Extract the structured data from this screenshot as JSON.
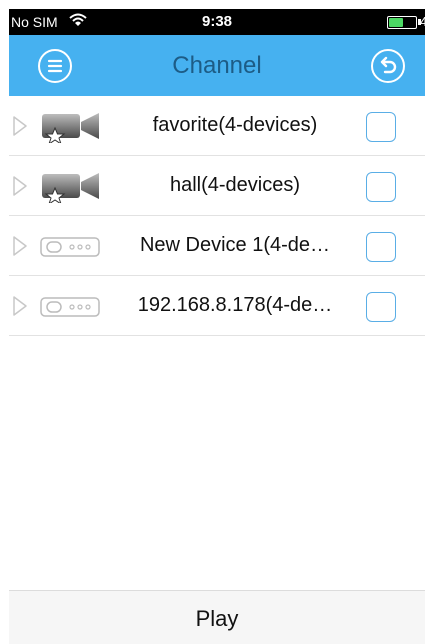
{
  "status_bar": {
    "carrier": "No SIM",
    "time": "9:38",
    "battery_level": 0.55,
    "battery_color": "#4cd964",
    "extra": "4"
  },
  "navbar": {
    "title": "Channel",
    "menu_icon": "hamburger-menu-icon",
    "back_icon": "undo-back-icon",
    "color": "#46b1f0",
    "title_color": "#1d5c86"
  },
  "channels": [
    {
      "label": "favorite(4-devices)",
      "icon": "camera-favorite-icon"
    },
    {
      "label": "hall(4-devices)",
      "icon": "camera-favorite-icon"
    },
    {
      "label": "New Device 1(4-de…",
      "icon": "dvr-device-icon"
    },
    {
      "label": "192.168.8.178(4-de…",
      "icon": "dvr-device-icon"
    }
  ],
  "bottom": {
    "play_label": "Play"
  }
}
